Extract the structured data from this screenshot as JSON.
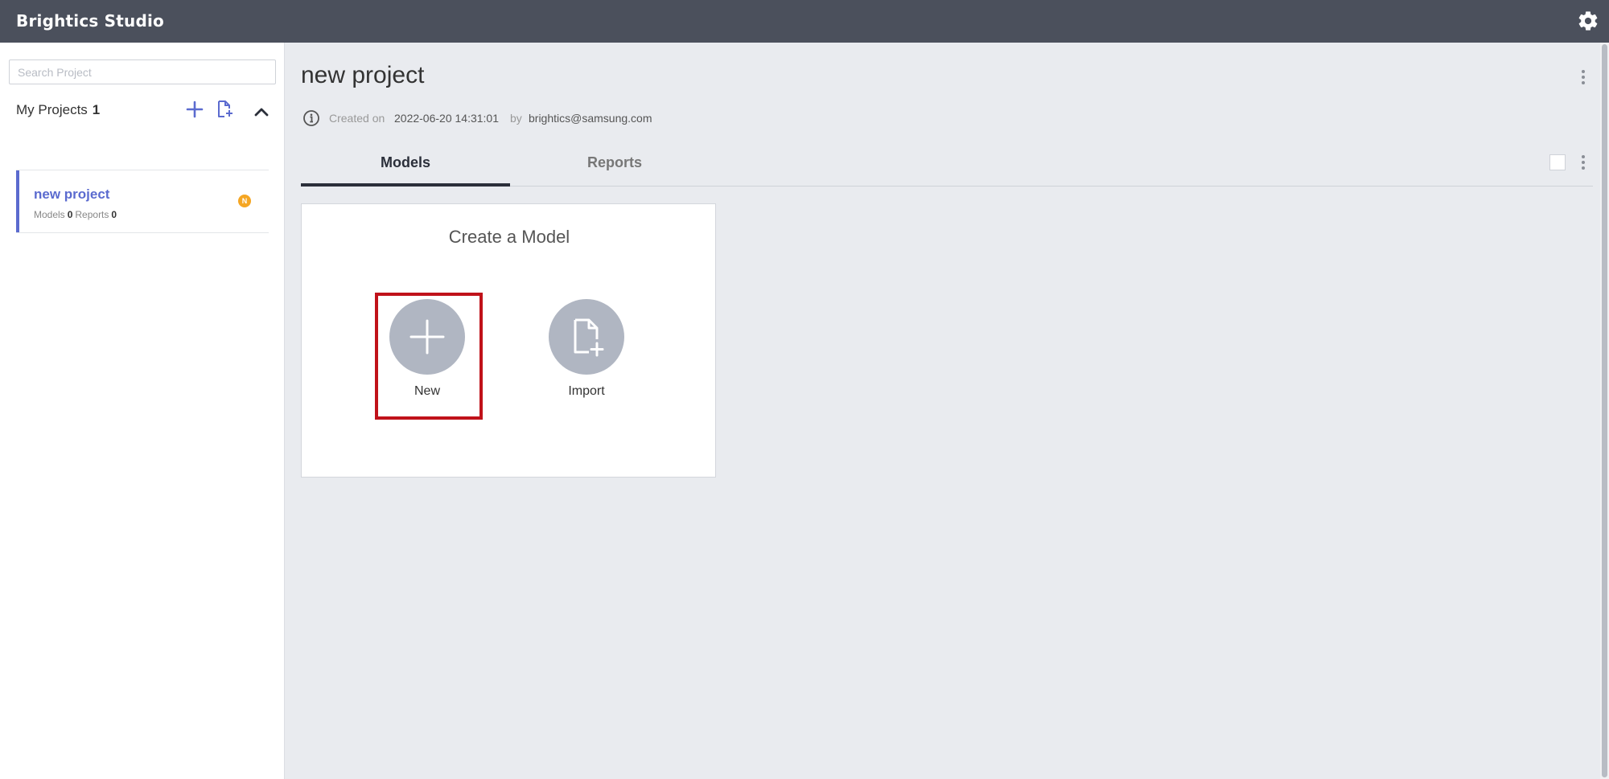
{
  "app": {
    "title": "Brightics Studio"
  },
  "sidebar": {
    "search_placeholder": "Search Project",
    "section_label": "My Projects",
    "project_count": "1",
    "projects": [
      {
        "name": "new project",
        "models_label": "Models",
        "models_count": "0",
        "reports_label": "Reports",
        "reports_count": "0",
        "badge": "N"
      }
    ]
  },
  "main": {
    "title": "new project",
    "created_label": "Created on",
    "created_date": "2022-06-20 14:31:01",
    "by_label": "by",
    "author": "brightics@samsung.com",
    "tabs": [
      {
        "label": "Models",
        "active": true
      },
      {
        "label": "Reports",
        "active": false
      }
    ],
    "card": {
      "title": "Create a Model",
      "new_label": "New",
      "import_label": "Import"
    }
  },
  "colors": {
    "topbar": "#4b505c",
    "accent": "#5b6bcf",
    "badge": "#f5a623",
    "highlight": "#c0121a",
    "action_circle": "#b0b6c2"
  },
  "icons": {
    "settings": "gear-icon",
    "add": "plus-icon",
    "import": "file-import-icon",
    "collapse": "chevron-up-icon",
    "info": "info-icon",
    "more": "kebab-icon"
  }
}
